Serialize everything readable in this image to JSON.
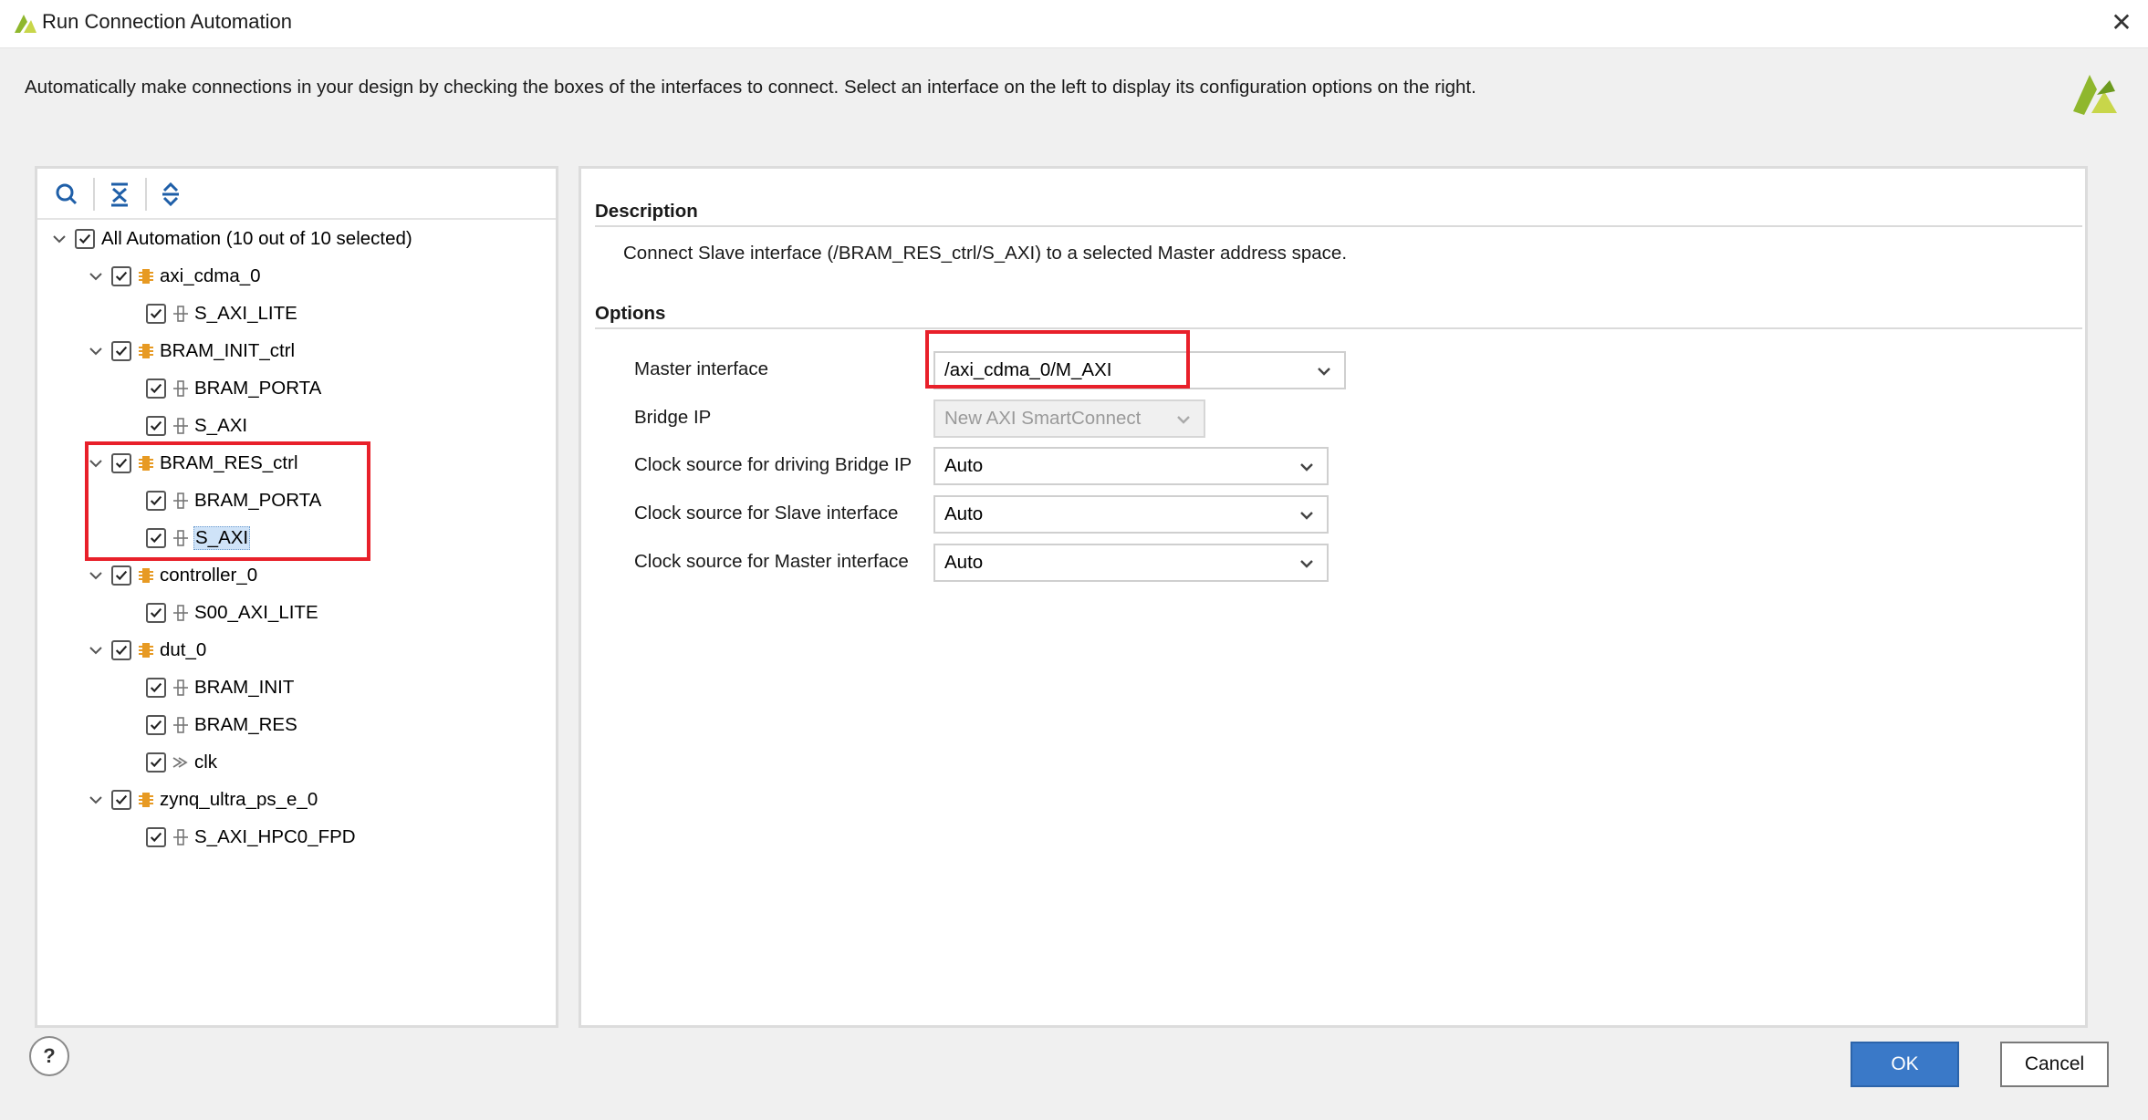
{
  "window": {
    "title": "Run Connection Automation",
    "close_icon": "close-icon"
  },
  "instructions": "Automatically make connections in your design by checking the boxes of the interfaces to connect. Select an interface on the left to display its configuration options on the right.",
  "tree": {
    "root": {
      "label": "All Automation (10 out of 10 selected)",
      "checked": true
    },
    "groups": [
      {
        "label": "axi_cdma_0",
        "checked": true,
        "children": [
          {
            "label": "S_AXI_LITE",
            "checked": true,
            "icon": "interface-icon"
          }
        ]
      },
      {
        "label": "BRAM_INIT_ctrl",
        "checked": true,
        "children": [
          {
            "label": "BRAM_PORTA",
            "checked": true,
            "icon": "interface-icon"
          },
          {
            "label": "S_AXI",
            "checked": true,
            "icon": "interface-icon"
          }
        ]
      },
      {
        "label": "BRAM_RES_ctrl",
        "checked": true,
        "children": [
          {
            "label": "BRAM_PORTA",
            "checked": true,
            "icon": "interface-icon"
          },
          {
            "label": "S_AXI",
            "checked": true,
            "icon": "interface-icon",
            "selected": true
          }
        ]
      },
      {
        "label": "controller_0",
        "checked": true,
        "children": [
          {
            "label": "S00_AXI_LITE",
            "checked": true,
            "icon": "interface-icon"
          }
        ]
      },
      {
        "label": "dut_0",
        "checked": true,
        "children": [
          {
            "label": "BRAM_INIT",
            "checked": true,
            "icon": "interface-icon"
          },
          {
            "label": "BRAM_RES",
            "checked": true,
            "icon": "interface-icon"
          },
          {
            "label": "clk",
            "checked": true,
            "icon": "clock-icon"
          }
        ]
      },
      {
        "label": "zynq_ultra_ps_e_0",
        "checked": true,
        "children": [
          {
            "label": "S_AXI_HPC0_FPD",
            "checked": true,
            "icon": "interface-icon"
          }
        ]
      }
    ]
  },
  "details": {
    "description_title": "Description",
    "description_text": "Connect Slave interface (/BRAM_RES_ctrl/S_AXI) to a selected Master address space.",
    "options_title": "Options",
    "options": [
      {
        "label": "Master interface",
        "value": "/axi_cdma_0/M_AXI",
        "enabled": true
      },
      {
        "label": "Bridge IP",
        "value": "New AXI SmartConnect",
        "enabled": false
      },
      {
        "label": "Clock source for driving Bridge IP",
        "value": "Auto",
        "enabled": true
      },
      {
        "label": "Clock source for Slave interface",
        "value": "Auto",
        "enabled": true
      },
      {
        "label": "Clock source for Master interface",
        "value": "Auto",
        "enabled": true
      }
    ]
  },
  "buttons": {
    "help": "?",
    "ok": "OK",
    "cancel": "Cancel"
  },
  "colors": {
    "accent": "#3a79c8",
    "highlight_box": "#e8202a",
    "selection": "#cfe3f8",
    "brand_logo": "#8fb72d"
  }
}
